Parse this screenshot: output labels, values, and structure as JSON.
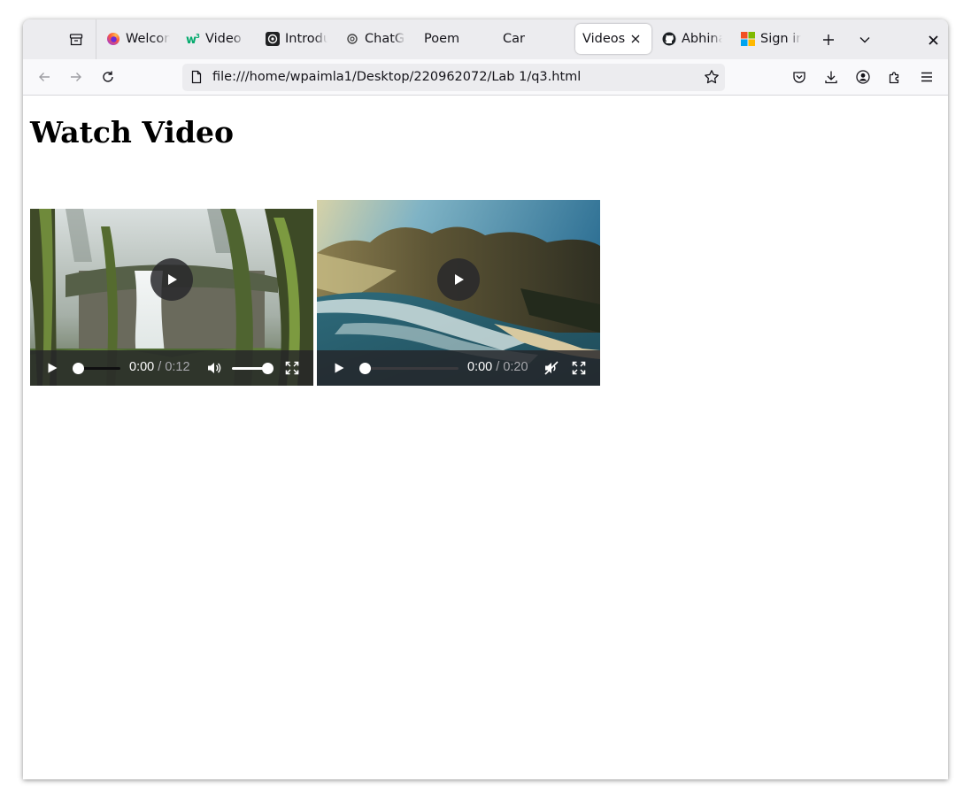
{
  "browser": {
    "tabs": [
      {
        "label": "Welcome to Firefox",
        "icon": "firefox-icon"
      },
      {
        "label": "Video Tag",
        "icon": "w3-icon"
      },
      {
        "label": "Introduction",
        "icon": "openai-icon"
      },
      {
        "label": "ChatGPT",
        "icon": "chatgpt-icon"
      },
      {
        "label": "Poem",
        "icon": ""
      },
      {
        "label": "Car",
        "icon": ""
      },
      {
        "label": "Videos",
        "icon": "",
        "active": true
      },
      {
        "label": "Abhinav",
        "icon": "github-icon"
      },
      {
        "label": "Sign in",
        "icon": "microsoft-icon"
      }
    ],
    "url": "file:///home/wpaimla1/Desktop/220962072/Lab 1/q3.html"
  },
  "page": {
    "heading": "Watch Video"
  },
  "videos": [
    {
      "current_time": "0:00",
      "duration": "/ 0:12",
      "muted": false,
      "volume": 1.0,
      "progress": 0.0,
      "scene": "forest waterfall"
    },
    {
      "current_time": "0:00",
      "duration": "/ 0:20",
      "muted": true,
      "volume": 0.0,
      "progress": 0.0,
      "scene": "coastal cliffs and ocean"
    }
  ],
  "colors": {
    "tabbar_bg": "#ececef",
    "toolbar_bg": "#f9f9fb",
    "urlbar_bg": "#ececef",
    "control_bg": "#242428"
  }
}
